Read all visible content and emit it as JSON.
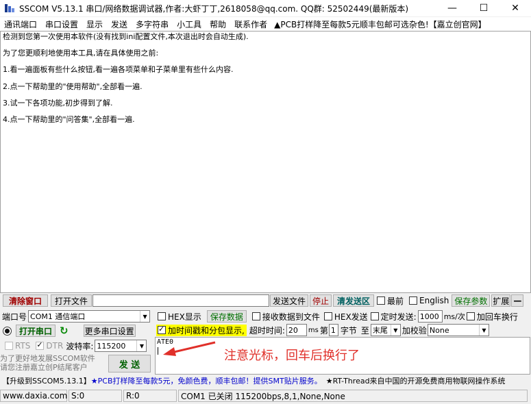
{
  "window": {
    "title": "SSCOM V5.13.1 串口/网络数据调试器,作者:大虾丁丁,2618058@qq.com. QQ群: 52502449(最新版本)",
    "minimize": "—",
    "maximize": "☐",
    "close": "✕"
  },
  "menu": [
    "通讯端口",
    "串口设置",
    "显示",
    "发送",
    "多字符串",
    "小工具",
    "帮助",
    "联系作者"
  ],
  "menu_promo": "▲PCB打样降至每款5元顺丰包邮可选杂色!【嘉立创官网】",
  "receive": {
    "lines": [
      "检测到您第一次使用本软件(没有找到ini配置文件,本次退出时会自动生成).",
      "为了您更顺利地使用本工具,请在具体使用之前:",
      "1.看一遍面板有些什么按钮,看一遍各项菜单和子菜单里有些什么内容.",
      "2.点一下帮助里的\"使用帮助\",全部看一遍.",
      "3.试一下各项功能,初步得到了解.",
      "4.点一下帮助里的\"问答集\",全部看一遍."
    ]
  },
  "toolbar": {
    "clear_window": "清除窗口",
    "open_file": "打开文件",
    "send_file": "发送文件",
    "stop": "停止",
    "clear_send": "清发送区",
    "topmost": "最前",
    "english": "English",
    "save_params": "保存参数",
    "expand": "扩展",
    "collapse": "—"
  },
  "port": {
    "label": "端口号",
    "value": "COM1 通信端口",
    "more_settings": "更多串口设置",
    "open_port": "打开串口",
    "rts": "RTS",
    "dtr": "DTR",
    "baud_label": "波特率:",
    "baud_value": "115200",
    "promo_text_1": "为了更好地发展SSCOM软件",
    "promo_text_2": "请您注册嘉立创P结尾客户",
    "send_button": "发 送"
  },
  "options": {
    "hex_display": "HEX显示",
    "save_data": "保存数据",
    "recv_to_file": "接收数据到文件",
    "hex_send": "HEX发送",
    "timed_send": "定时发送:",
    "interval_value": "1000",
    "interval_unit": "ms/次",
    "add_newline": "加回车换行",
    "timestamp": "加时间戳和分包显示,",
    "timeout_label": "超时时间:",
    "timeout_value": "20",
    "timeout_unit": "ms",
    "nth_label": "第",
    "nth_value": "1",
    "byte_label": "字节",
    "to_label": "至",
    "end_value": "末尾",
    "checksum_label": "加校验",
    "checksum_value": "None"
  },
  "send": {
    "text": "ATE0",
    "annotation": "注意光标，回车后换行了"
  },
  "promo_bar": {
    "part1": "【升级到SSCOM5.13.1】",
    "part2": "★PCB打样降至每款5元，免颜色费，顺丰包邮！提供SMT贴片服务。",
    "part3": "★RT-Thread来自中国的开源免费商用物联网操作系统"
  },
  "status": {
    "website": "www.daxia.com",
    "sent": "S:0",
    "received": "R:0",
    "port_status": "COM1 已关闭  115200bps,8,1,None,None"
  }
}
